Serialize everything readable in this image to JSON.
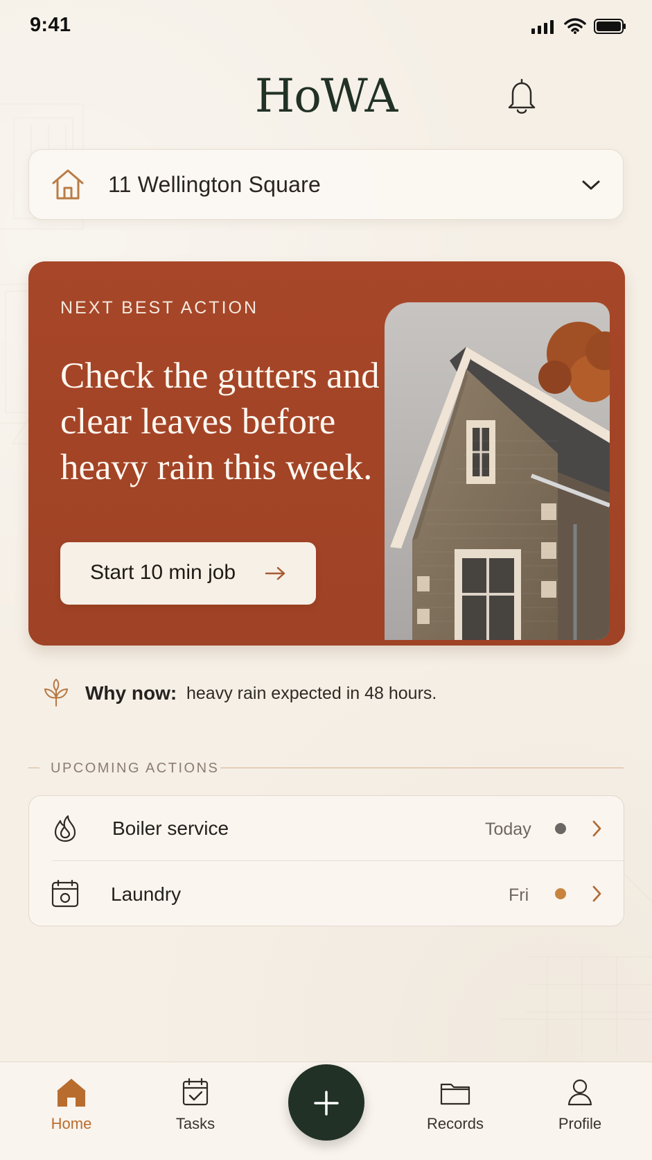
{
  "status_bar": {
    "time": "9:41",
    "icons": [
      "signal-icon",
      "wifi-icon",
      "battery-icon"
    ]
  },
  "header": {
    "app_name": "HoWA",
    "notification_icon": "bell-icon"
  },
  "property": {
    "name": "11 Wellington Square",
    "icon": "home-outline-icon",
    "expand_icon": "chevron-down-icon"
  },
  "hero": {
    "kicker": "NEXT BEST ACTION",
    "title": "Check the gutters and\nclear leaves before\nheavy rain this week.",
    "button_label": "Start 10 min job",
    "button_icon": "arrow-right-icon",
    "image_subject": "stone house with pitched roof and autumn tree"
  },
  "why_now": {
    "icon": "sprout-icon",
    "label": "Why now:",
    "text": "heavy rain expected in 48 hours."
  },
  "upcoming": {
    "title": "UPCOMING ACTIONS",
    "items": [
      {
        "title": "Boiler service",
        "when": "Today",
        "icon": "flame-icon",
        "status_color": "#6b6764"
      },
      {
        "title": "Laundry",
        "when": "Fri",
        "icon": "calendar-washer-icon",
        "status_color": "#c8843f"
      }
    ]
  },
  "navigation": {
    "items": [
      {
        "label": "Home",
        "icon": "home-filled-icon",
        "active": true
      },
      {
        "label": "Tasks",
        "icon": "calendar-check-icon",
        "active": false
      },
      {
        "label": "Records",
        "icon": "folder-icon",
        "active": false
      },
      {
        "label": "Profile",
        "icon": "user-icon",
        "active": false
      }
    ],
    "fab_icon": "plus-icon"
  },
  "colors": {
    "background": "#f5efe6",
    "brand_green": "#213126",
    "hero_rust": "#a74628",
    "accent_tan": "#b86d2f"
  }
}
